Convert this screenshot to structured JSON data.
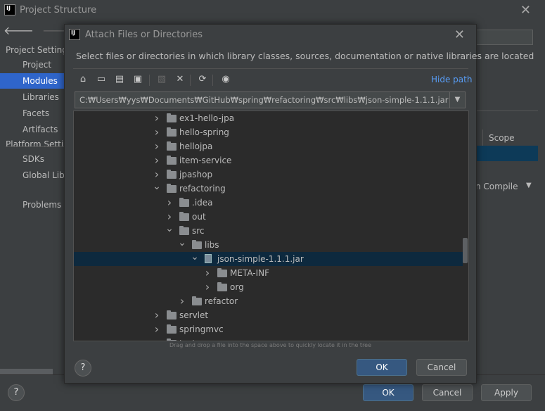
{
  "outer": {
    "app_icon": "IJ",
    "title": "Project Structure",
    "close": "✕",
    "back": "🡐",
    "forward": "🡒",
    "sidebar": [
      {
        "label": "Project Settings",
        "type": "section"
      },
      {
        "label": "Project",
        "type": "child"
      },
      {
        "label": "Modules",
        "type": "child",
        "selected": true
      },
      {
        "label": "Libraries",
        "type": "child"
      },
      {
        "label": "Facets",
        "type": "child"
      },
      {
        "label": "Artifacts",
        "type": "child"
      },
      {
        "label": "Platform Settings",
        "type": "section"
      },
      {
        "label": "SDKs",
        "type": "child"
      },
      {
        "label": "Global Libraries",
        "type": "child"
      },
      {
        "label": "Problems",
        "type": "child"
      }
    ],
    "scope_header": "Scope",
    "compile_label": "n Compile",
    "compile_arrow": "▼",
    "help": "?",
    "ok": "OK",
    "cancel": "Cancel",
    "apply": "Apply"
  },
  "dialog": {
    "app_icon": "IJ",
    "title": "Attach Files or Directories",
    "close": "✕",
    "description": "Select files or directories in which library classes, sources, documentation or native libraries are located",
    "hide_path": "Hide path",
    "path": "C:₩Users₩yys₩Documents₩GitHub₩spring₩refactoring₩src₩libs₩json-simple-1.1.1.jar",
    "path_arrow": "▼",
    "toolbar": [
      {
        "icon": "home-icon",
        "glyph": "⌂",
        "enabled": true
      },
      {
        "icon": "desktop-icon",
        "glyph": "▭",
        "enabled": true
      },
      {
        "icon": "project-folder-icon",
        "glyph": "▤",
        "enabled": true
      },
      {
        "icon": "module-folder-icon",
        "glyph": "▣",
        "enabled": true
      },
      {
        "icon": "new-folder-icon",
        "glyph": "▧",
        "enabled": false
      },
      {
        "icon": "delete-icon",
        "glyph": "✕",
        "enabled": true
      },
      {
        "icon": "refresh-icon",
        "glyph": "⟳",
        "enabled": true
      },
      {
        "icon": "show-hidden-icon",
        "glyph": "◉",
        "enabled": true
      }
    ],
    "tree": [
      {
        "label": "ex1-hello-jpa",
        "depth": 0,
        "expanded": false,
        "kind": "folder"
      },
      {
        "label": "hello-spring",
        "depth": 0,
        "expanded": false,
        "kind": "folder"
      },
      {
        "label": "hellojpa",
        "depth": 0,
        "expanded": false,
        "kind": "folder"
      },
      {
        "label": "item-service",
        "depth": 0,
        "expanded": false,
        "kind": "folder"
      },
      {
        "label": "jpashop",
        "depth": 0,
        "expanded": false,
        "kind": "folder"
      },
      {
        "label": "refactoring",
        "depth": 0,
        "expanded": true,
        "kind": "folder"
      },
      {
        "label": ".idea",
        "depth": 1,
        "expanded": false,
        "kind": "folder"
      },
      {
        "label": "out",
        "depth": 1,
        "expanded": false,
        "kind": "folder"
      },
      {
        "label": "src",
        "depth": 1,
        "expanded": true,
        "kind": "folder"
      },
      {
        "label": "libs",
        "depth": 2,
        "expanded": true,
        "kind": "folder"
      },
      {
        "label": "json-simple-1.1.1.jar",
        "depth": 3,
        "expanded": true,
        "kind": "jar",
        "selected": true
      },
      {
        "label": "META-INF",
        "depth": 4,
        "expanded": false,
        "kind": "folder"
      },
      {
        "label": "org",
        "depth": 4,
        "expanded": false,
        "kind": "folder"
      },
      {
        "label": "refactor",
        "depth": 2,
        "expanded": false,
        "kind": "folder"
      },
      {
        "label": "servlet",
        "depth": 0,
        "expanded": false,
        "kind": "folder"
      },
      {
        "label": "springmvc",
        "depth": 0,
        "expanded": false,
        "kind": "folder"
      },
      {
        "label": "test",
        "depth": 0,
        "expanded": false,
        "kind": "folder"
      }
    ],
    "drag_hint": "Drag and drop a file into the space above to quickly locate it in the tree",
    "help": "?",
    "ok": "OK",
    "cancel": "Cancel"
  }
}
